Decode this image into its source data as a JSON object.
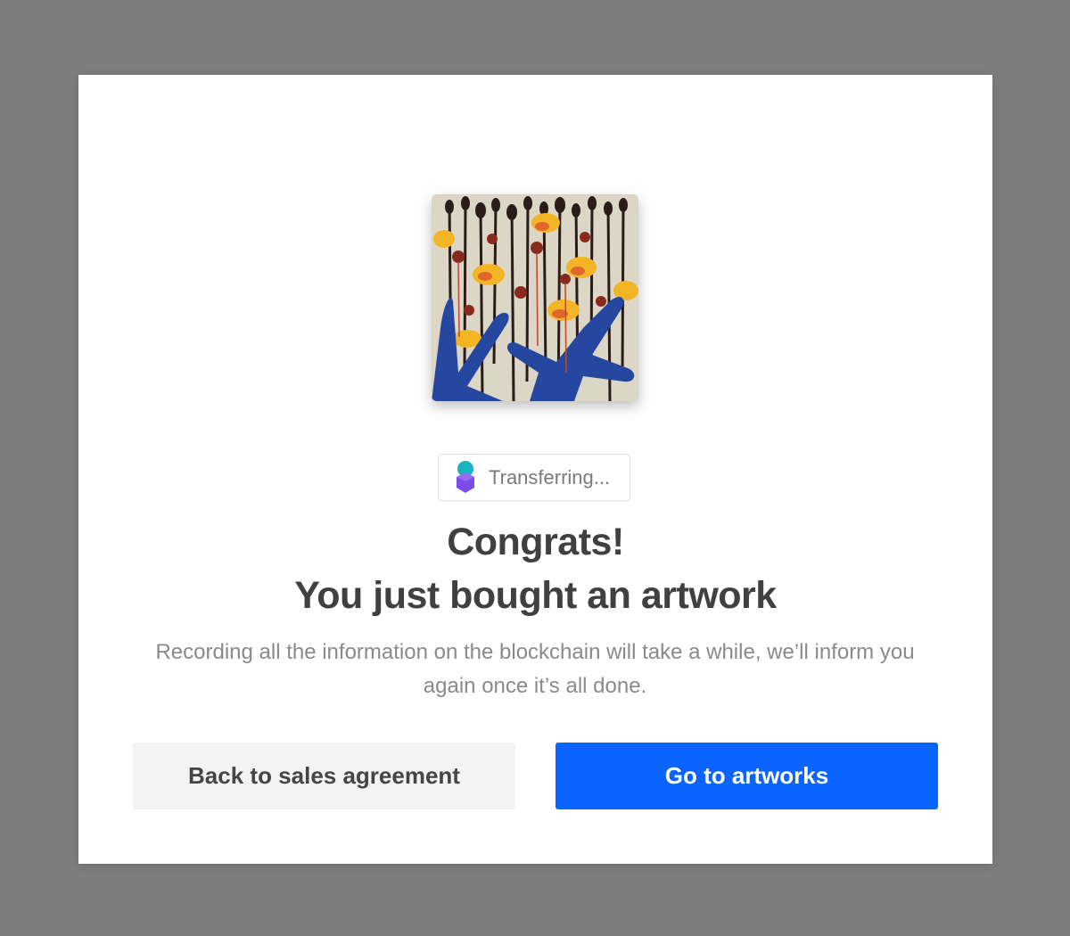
{
  "modal": {
    "artwork_image": "abstract flower painting",
    "status": {
      "icon": "blockchain-logo-icon",
      "text": "Transferring..."
    },
    "title_line1": "Congrats!",
    "title_line2": "You just bought an artwork",
    "message": "Recording all the information on the blockchain will take a while, we’ll inform you again once it’s all done.",
    "buttons": {
      "back_label": "Back to sales agreement",
      "go_label": "Go to artworks"
    }
  },
  "colors": {
    "backdrop": "#7d7d7d",
    "primary": "#0a64ff",
    "secondary_bg": "#f3f3f3",
    "title": "#404040",
    "body_text": "#8a8a8a"
  }
}
